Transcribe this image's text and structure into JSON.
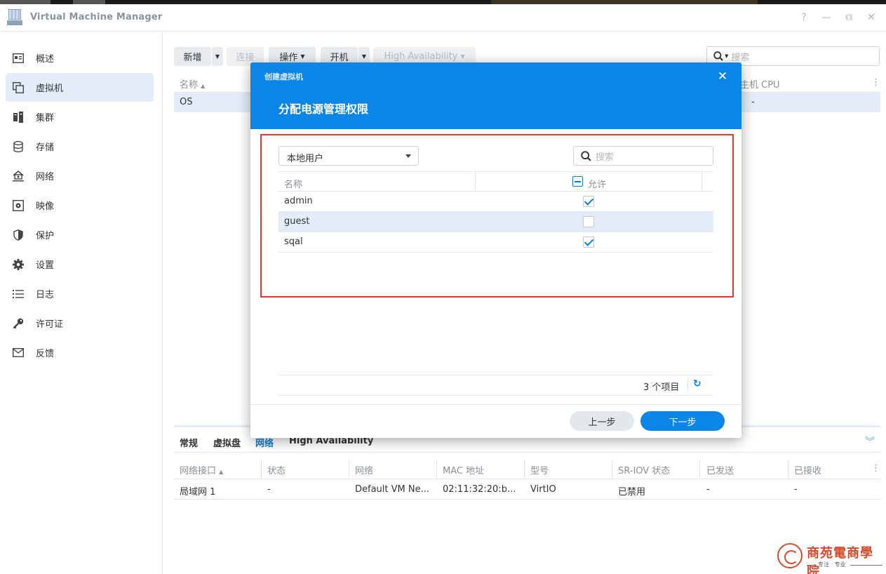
{
  "window": {
    "title": "Virtual Machine Manager",
    "controls": {
      "help": "?",
      "minimize": "—",
      "restore": "⧉",
      "close": "✕"
    }
  },
  "sidebar": {
    "items": [
      {
        "label": "概述",
        "icon": "overview-icon"
      },
      {
        "label": "虚拟机",
        "icon": "virtual-machine-icon",
        "active": true
      },
      {
        "label": "集群",
        "icon": "cluster-icon"
      },
      {
        "label": "存储",
        "icon": "storage-icon"
      },
      {
        "label": "网络",
        "icon": "network-icon"
      },
      {
        "label": "映像",
        "icon": "image-icon"
      },
      {
        "label": "保护",
        "icon": "shield-icon"
      },
      {
        "label": "设置",
        "icon": "gear-icon"
      },
      {
        "label": "日志",
        "icon": "list-icon"
      },
      {
        "label": "许可证",
        "icon": "key-icon"
      },
      {
        "label": "反馈",
        "icon": "mail-icon"
      }
    ]
  },
  "toolbar": {
    "new_label": "新增",
    "connect_label": "连接",
    "action_label": "操作",
    "power_on_label": "开机",
    "ha_label": "High Availability",
    "search_placeholder": "搜索"
  },
  "vm_table": {
    "columns": [
      "名称",
      "主机 CPU"
    ],
    "rows": [
      {
        "name": "OS",
        "host_cpu": "-"
      }
    ]
  },
  "bottom_panel": {
    "tabs": [
      "常规",
      "虚拟盘",
      "网络",
      "High Availability"
    ],
    "active_tab": "网络",
    "columns": [
      "网络接口",
      "状态",
      "网络",
      "MAC 地址",
      "型号",
      "SR-IOV 状态",
      "已发送",
      "已接收"
    ],
    "rows": [
      [
        "局域网 1",
        "-",
        "Default VM Ne...",
        "02:11:32:20:b...",
        "VirtIO",
        "已禁用",
        "-",
        "-"
      ]
    ]
  },
  "modal": {
    "crumb": "创建虚拟机",
    "title": "分配电源管理权限",
    "close": "✕",
    "user_type": "本地用户",
    "search_placeholder": "搜索",
    "columns": {
      "name": "名称",
      "allow": "允许"
    },
    "users": [
      {
        "name": "admin",
        "allowed": true
      },
      {
        "name": "guest",
        "allowed": false
      },
      {
        "name": "sqal",
        "allowed": true
      }
    ],
    "count": "3 个项目",
    "prev_label": "上一步",
    "next_label": "下一步"
  },
  "watermark": {
    "brand": "商苑電商學院",
    "sub": "专注 · 专业"
  },
  "colors": {
    "accent": "#0b86e6",
    "selection": "#e2edf9",
    "highlight_border": "#d93b34"
  }
}
